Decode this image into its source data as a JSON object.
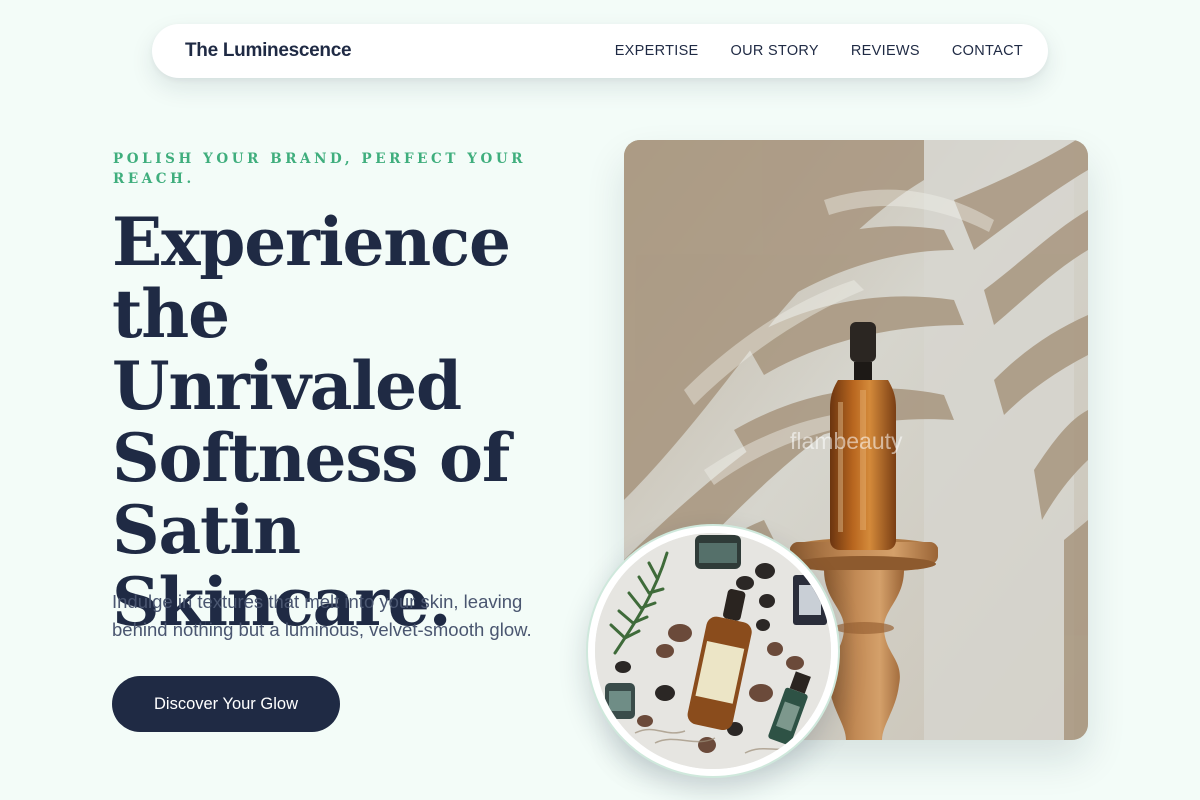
{
  "nav": {
    "brand": "The Luminescence",
    "links": [
      {
        "label": "EXPERTISE"
      },
      {
        "label": "OUR STORY"
      },
      {
        "label": "REVIEWS"
      },
      {
        "label": "CONTACT"
      }
    ]
  },
  "hero": {
    "eyebrow": "POLISH YOUR BRAND, PERFECT YOUR REACH.",
    "headline_lines": [
      "Experience",
      "the Unrivaled",
      "Softness of",
      "Satin",
      "Skincare."
    ],
    "lede": "Indulge in textures that melt into your skin, leaving behind nothing but a luminous, velvet-smooth glow.",
    "cta_label": "Discover Your Glow"
  },
  "images": {
    "main_watermark": "flambeauty",
    "main_icon": "dropper-bottle-photo",
    "inset_icon": "skincare-flatlay-photo"
  },
  "colors": {
    "background": "#f3fcf8",
    "navy": "#1f2a44",
    "accent_green": "#3fae7d",
    "body_text": "#4a5670"
  }
}
